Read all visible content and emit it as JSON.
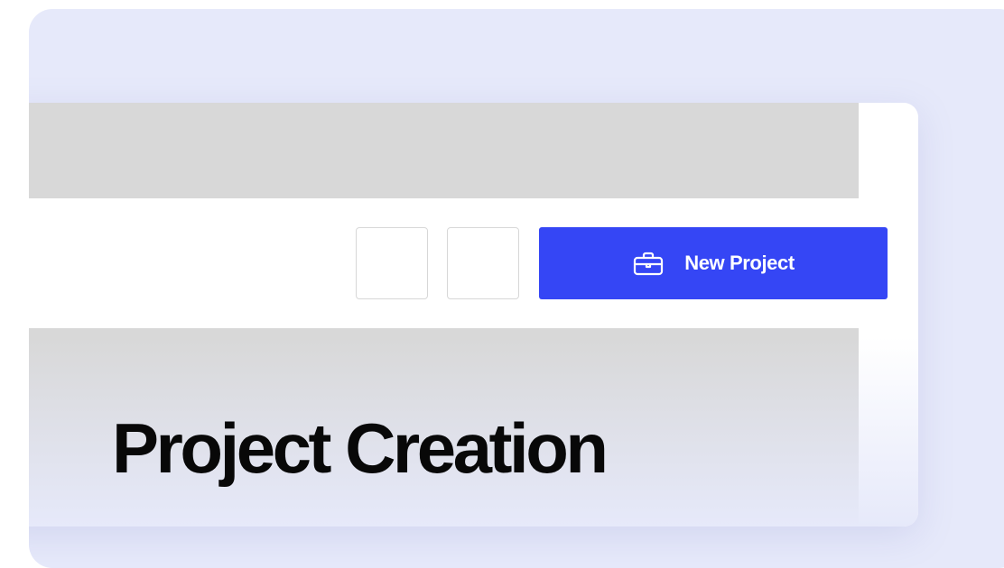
{
  "toolbar": {
    "new_project_label": "New Project",
    "new_project_icon": "briefcase-icon",
    "accent_color": "#3546f5"
  },
  "page": {
    "title": "Project Creation"
  },
  "colors": {
    "background": "#e6e9fa",
    "panel": "#ffffff",
    "placeholder_gray": "#d8d8d8"
  }
}
